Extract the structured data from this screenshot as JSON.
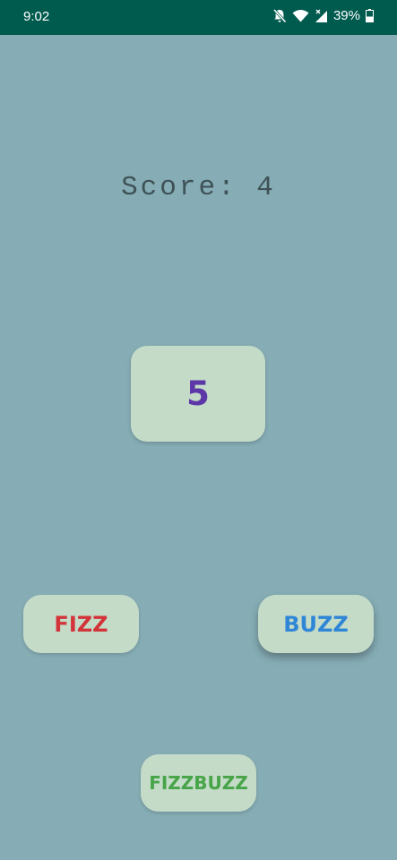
{
  "status_bar": {
    "time": "9:02",
    "battery_percent": "39%",
    "icons": [
      "notifications-off-icon",
      "wifi-icon",
      "cell-signal-icon",
      "battery-icon"
    ],
    "background_color": "#005b4f"
  },
  "game": {
    "score_text": "Score: 4",
    "current_number": "5",
    "buttons": {
      "fizz": "FIZZ",
      "buzz": "BUZZ",
      "fizzbuzz": "FIZZBUZZ"
    },
    "colors": {
      "background": "#86adb5",
      "card": "#c4dbc8",
      "number": "#5d36a8",
      "fizz": "#d2343a",
      "buzz": "#2f86d6",
      "fizzbuzz": "#47a448"
    }
  }
}
